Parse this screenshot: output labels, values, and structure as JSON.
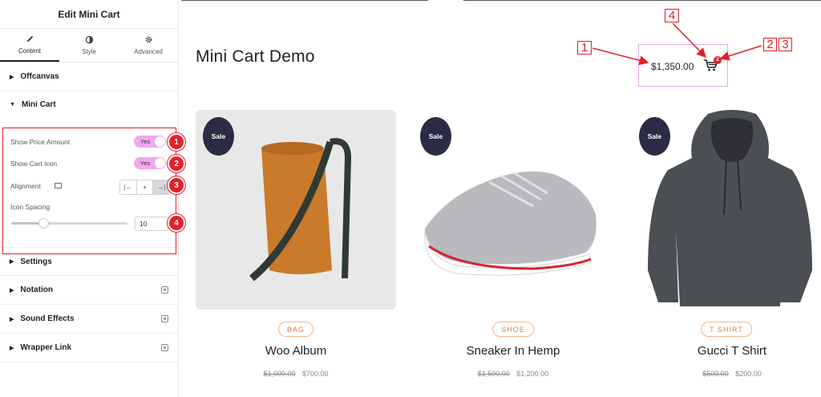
{
  "panel": {
    "title": "Edit Mini Cart",
    "tabs": [
      {
        "label": "Content",
        "icon": "pencil-icon"
      },
      {
        "label": "Style",
        "icon": "contrast-icon"
      },
      {
        "label": "Advanced",
        "icon": "gear-icon"
      }
    ],
    "sections": {
      "offcanvas": "Offcanvas",
      "mini_cart": "Mini Cart",
      "settings": "Settings",
      "notation": "Notation",
      "sound_effects": "Sound Effects",
      "wrapper_link": "Wrapper Link"
    },
    "controls": {
      "show_price_label": "Show Price Amount",
      "show_price_value": "Yes",
      "show_cart_label": "Show Cart Icon",
      "show_cart_value": "Yes",
      "alignment_label": "Alignment",
      "alignment_options": [
        "|←",
        "+",
        "→|"
      ],
      "icon_spacing_label": "Icon Spacing",
      "icon_spacing_value": "10",
      "icon_spacing_fraction": 0.1
    },
    "markers": [
      "1",
      "2",
      "3",
      "4"
    ]
  },
  "page": {
    "title": "Mini Cart Demo",
    "mini_cart": {
      "price": "$1,350.00",
      "count": "2"
    },
    "callouts": [
      "1",
      "2",
      "3",
      "4"
    ]
  },
  "products": [
    {
      "sale": "Sale",
      "category": "BAG",
      "name": "Woo Album",
      "old_price": "$1,000.00",
      "price": "$700.00"
    },
    {
      "sale": "Sale",
      "category": "SHOE",
      "name": "Sneaker In Hemp",
      "old_price": "$1,500.00",
      "price": "$1,200.00"
    },
    {
      "sale": "Sale",
      "category": "T SHIRT",
      "name": "Gucci T Shirt",
      "old_price": "$500.00",
      "price": "$200.00"
    }
  ],
  "colors": {
    "accent_pink": "#f1a7ee",
    "callout_red": "#e0202a",
    "sale_badge": "#2b2b45",
    "category_orange": "#e67e3c"
  }
}
